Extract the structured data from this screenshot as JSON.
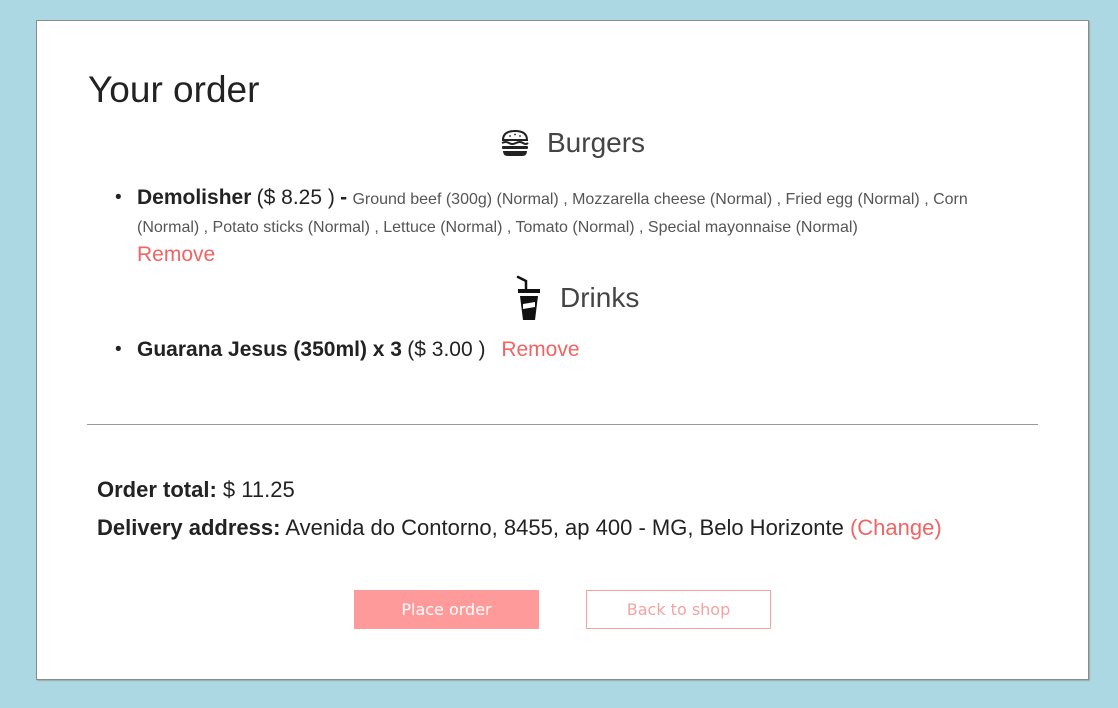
{
  "page": {
    "title": "Your order"
  },
  "categories": [
    {
      "name": "Burgers",
      "icon": "burger-icon",
      "items": [
        {
          "name": "Demolisher",
          "price": "($ 8.25 )",
          "separator": "-",
          "ingredients": "Ground beef (300g) (Normal) , Mozzarella cheese (Normal) , Fried egg (Normal) , Corn (Normal) , Potato sticks (Normal) , Lettuce (Normal) , Tomato (Normal) , Special mayonnaise (Normal)",
          "remove_label": "Remove"
        }
      ]
    },
    {
      "name": "Drinks",
      "icon": "drink-cup-icon",
      "items": [
        {
          "name": "Guarana Jesus (350ml) x 3",
          "price": "($ 3.00 )",
          "remove_label": "Remove"
        }
      ]
    }
  ],
  "summary": {
    "total_label": "Order total:",
    "total_value": "$ 11.25",
    "address_label": "Delivery address:",
    "address_value": "Avenida do Contorno, 8455, ap 400 - MG, Belo Horizonte",
    "change_label": "(Change)"
  },
  "actions": {
    "place_order_label": "Place order",
    "back_to_shop_label": "Back to shop"
  },
  "colors": {
    "background": "#acd8e4",
    "accent": "#f06464",
    "primary_button": "#ff9a9a"
  }
}
